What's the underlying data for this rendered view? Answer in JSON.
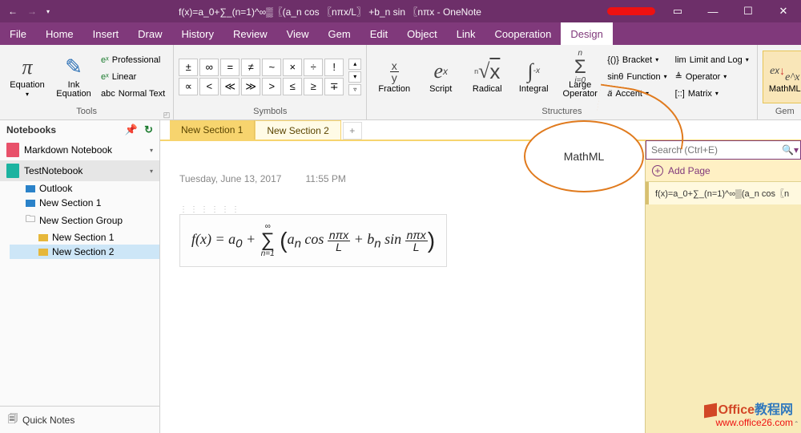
{
  "title": "f(x)=a_0+∑_(n=1)^∞▒〖(a_n  cos 〖nπx/L〗  +b_n  sin 〖nπx - OneNote",
  "menubar": [
    "File",
    "Home",
    "Insert",
    "Draw",
    "History",
    "Review",
    "View",
    "Gem",
    "Edit",
    "Object",
    "Link",
    "Cooperation",
    "Design"
  ],
  "menubar_active": "Design",
  "ribbon": {
    "tools": {
      "label": "Tools",
      "equation": "Equation",
      "ink": "Ink\nEquation",
      "convert": [
        "Professional",
        "Linear",
        "Normal Text"
      ]
    },
    "symbols": {
      "label": "Symbols",
      "cells": [
        "±",
        "∞",
        "=",
        "≠",
        "~",
        "×",
        "÷",
        "!",
        "∝",
        "<",
        "≪",
        "≫",
        ">",
        "≤",
        "≥",
        "∓"
      ]
    },
    "structures": {
      "label": "Structures",
      "fraction": "Fraction",
      "script": "Script",
      "radical": "Radical",
      "integral": "Integral",
      "large": "Large\nOperator",
      "bracket": "Bracket",
      "function": "Function",
      "accent": "Accent",
      "limit": "Limit and Log",
      "operator": "Operator",
      "matrix": "Matrix"
    },
    "gem": {
      "label": "Gem",
      "mathml": "MathML"
    }
  },
  "nav": {
    "header": "Notebooks",
    "notebooks": [
      {
        "name": "Markdown Notebook",
        "color": "#e8516a"
      },
      {
        "name": "TestNotebook",
        "color": "#1cb3a0",
        "active": true
      }
    ],
    "tree": [
      {
        "name": "Outlook",
        "type": "section",
        "color": "#2a82c9"
      },
      {
        "name": "New Section 1",
        "type": "section",
        "color": "#2a82c9"
      },
      {
        "name": "New Section Group",
        "type": "group"
      },
      {
        "name": "New Section 1",
        "type": "section",
        "color": "#e6b73a",
        "indent": 1
      },
      {
        "name": "New Section 2",
        "type": "section",
        "color": "#e6b73a",
        "indent": 1,
        "active": true
      }
    ],
    "quicknotes": "Quick Notes"
  },
  "tabs": {
    "items": [
      "New Section 1",
      "New Section 2"
    ],
    "active": 1
  },
  "page": {
    "date": "Tuesday, June 13, 2017",
    "time": "11:55 PM",
    "formula_plain": "f(x) = a₀ + Σ (aₙ cos nπx/L + bₙ sin nπx/L)"
  },
  "pagepane": {
    "search_placeholder": "Search (Ctrl+E)",
    "addpage": "Add Page",
    "pages": [
      "f(x)=a_0+∑_(n=1)^∞▒(a_n  cos〖n"
    ]
  },
  "callout": "MathML",
  "watermark": {
    "line1a": "Office",
    "line1b": "教程网",
    "line2": "www.office26.com"
  }
}
